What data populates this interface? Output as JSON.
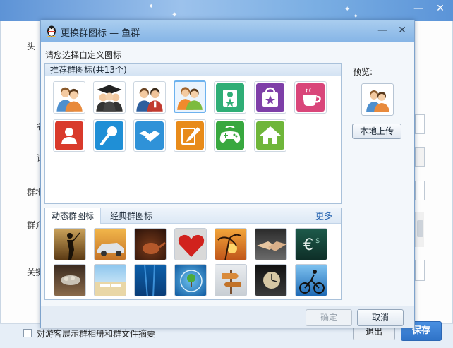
{
  "background": {
    "labels": [
      "头",
      "名",
      "话",
      "群地",
      "群介",
      "关键"
    ],
    "green_mark": "o",
    "checkbox_label": "对游客展示群相册和群文件摘要",
    "exit_label": "退出",
    "save_label": "保存",
    "minimize_label": "—",
    "close_label": "✕"
  },
  "dialog": {
    "title": "更换群图标 — 鱼群",
    "minimize_label": "—",
    "close_label": "✕",
    "prompt": "请您选择自定义图标",
    "recommended": {
      "header": "推荐群图标(共13个)",
      "icons": [
        {
          "name": "people-icon",
          "color": "#ffffff"
        },
        {
          "name": "graduation-icon",
          "color": "#ffffff"
        },
        {
          "name": "business-people-icon",
          "color": "#ffffff"
        },
        {
          "name": "friends-icon",
          "color": "#ffffff"
        },
        {
          "name": "id-card-icon",
          "color": "#2fae76"
        },
        {
          "name": "shopping-bag-icon",
          "color": "#7e3fa8"
        },
        {
          "name": "coffee-cup-icon",
          "color": "#d9467a"
        },
        {
          "name": "contact-icon",
          "color": "#d93a2b"
        },
        {
          "name": "microphone-icon",
          "color": "#1f8fd6"
        },
        {
          "name": "handshake-icon",
          "color": "#2f92d8"
        },
        {
          "name": "pencil-icon",
          "color": "#e88b1a"
        },
        {
          "name": "gamepad-icon",
          "color": "#38a83f"
        },
        {
          "name": "home-icon",
          "color": "#6fb63a"
        }
      ]
    },
    "tabs": {
      "dynamic": "动态群图标",
      "classic": "经典群图标",
      "more": "更多"
    },
    "photos": [
      "golfer-photo-icon",
      "car-photo-icon",
      "teapot-photo-icon",
      "heart-photo-icon",
      "palm-sunset-photo-icon",
      "handshake-photo-icon",
      "currency-photo-icon",
      "coins-hands-photo-icon",
      "beach-photo-icon",
      "underwater-photo-icon",
      "globe-tree-photo-icon",
      "signpost-photo-icon",
      "clock-photo-icon",
      "cyclist-photo-icon"
    ],
    "preview_label": "预览:",
    "upload_label": "本地上传",
    "ok_label": "确定",
    "cancel_label": "取消"
  }
}
